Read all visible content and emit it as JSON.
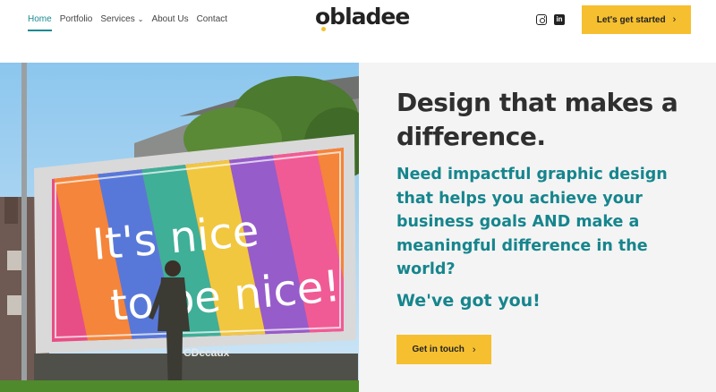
{
  "header": {
    "nav": [
      {
        "label": "Home",
        "active": true
      },
      {
        "label": "Portfolio"
      },
      {
        "label": "Services",
        "has_dropdown": true
      },
      {
        "label": "About Us"
      },
      {
        "label": "Contact"
      }
    ],
    "logo_text": "obladee",
    "social_icons": [
      "instagram-icon",
      "linkedin-icon"
    ],
    "cta_label": "Let's get started",
    "cta_arrow": "›"
  },
  "hero": {
    "billboard": {
      "line1": "It's nice",
      "line2": "to be nice!",
      "brand": "CDecaux"
    },
    "headline": "Design that makes a difference.",
    "subheadline": "Need impactful graphic design that helps you achieve your business goals AND make a meaningful difference in the world?",
    "tagline": "We've got you!",
    "cta_label": "Get in touch",
    "cta_arrow": "›"
  },
  "colors": {
    "accent_teal": "#16858d",
    "button_yellow": "#f5bf2f",
    "heading_dark": "#2f2f2f"
  }
}
